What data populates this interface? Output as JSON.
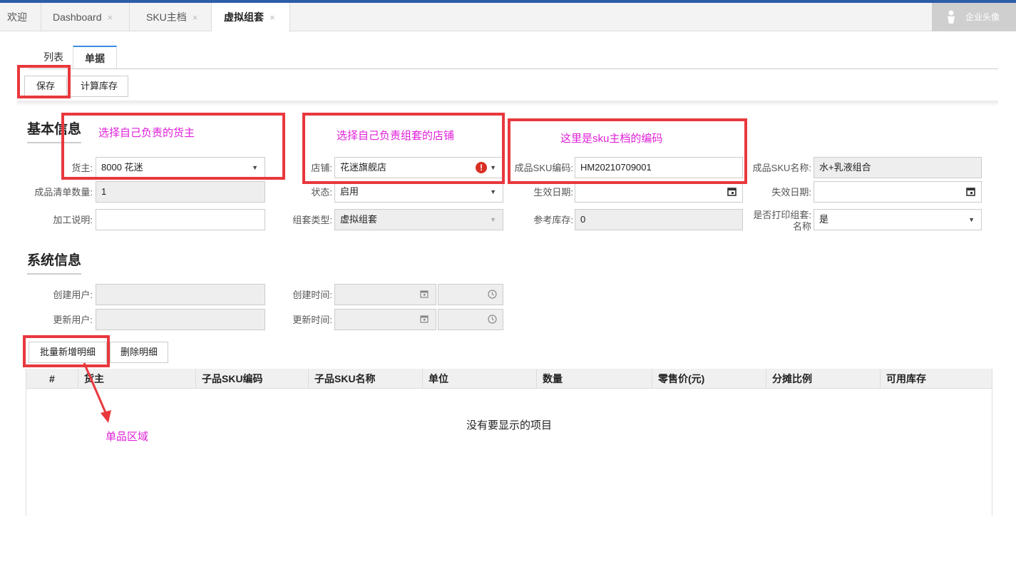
{
  "tabs": [
    {
      "label": "欢迎",
      "closable": false
    },
    {
      "label": "Dashboard",
      "closable": true
    },
    {
      "label": "SKU主档",
      "closable": true
    },
    {
      "label": "虚拟组套",
      "closable": true,
      "active": true
    }
  ],
  "tab_close_glyph": "×",
  "user": {
    "avatar_label": "企业头像"
  },
  "subtabs": [
    "列表",
    "单据"
  ],
  "toolbar": {
    "save": "保存",
    "calc_stock": "计算库存"
  },
  "basic": {
    "title": "基本信息",
    "owner": {
      "label": "货主:",
      "value": "8000 花迷"
    },
    "shop": {
      "label": "店铺:",
      "value": "花迷旗舰店"
    },
    "sku_code": {
      "label": "成品SKU编码:",
      "value": "HM20210709001"
    },
    "sku_name": {
      "label": "成品SKU名称:",
      "value": "水+乳液组合"
    },
    "bom_qty": {
      "label": "成品清单数量:",
      "value": "1"
    },
    "status": {
      "label": "状态:",
      "value": "启用"
    },
    "effective_date": {
      "label": "生效日期:",
      "value": ""
    },
    "expire_date": {
      "label": "失效日期:",
      "value": ""
    },
    "process_note": {
      "label": "加工说明:",
      "value": ""
    },
    "kit_type": {
      "label": "组套类型:",
      "value": "虚拟组套"
    },
    "ref_stock": {
      "label": "参考库存:",
      "value": "0"
    },
    "print_kit_name": {
      "label_line1": "是否打印组套:",
      "label_line2": "名称",
      "value": "是"
    }
  },
  "system": {
    "title": "系统信息",
    "created_by": {
      "label": "创建用户:",
      "value": ""
    },
    "created_at": {
      "label": "创建时间:",
      "value": ""
    },
    "updated_by": {
      "label": "更新用户:",
      "value": ""
    },
    "updated_at": {
      "label": "更新时间:",
      "value": ""
    }
  },
  "detail_buttons": {
    "batch_add": "批量新增明细",
    "delete": "删除明细"
  },
  "grid": {
    "columns": [
      "#",
      "货主",
      "子品SKU编码",
      "子品SKU名称",
      "单位",
      "数量",
      "零售价(元)",
      "分摊比例",
      "可用库存"
    ],
    "empty_text": "没有要显示的项目"
  },
  "annotations": {
    "owner_note": "选择自己负责的货主",
    "shop_note": "选择自己负责组套的店铺",
    "sku_note": "这里是sku主档的编码",
    "item_area_note": "单品区域",
    "color": "#e020d8",
    "box_color": "#e8383d"
  },
  "colors": {
    "accent": "#2b5da8",
    "tab_underline": "#3a8ee6",
    "error": "#d93025"
  },
  "icons": {
    "dropdown": "▼",
    "error": "!"
  }
}
